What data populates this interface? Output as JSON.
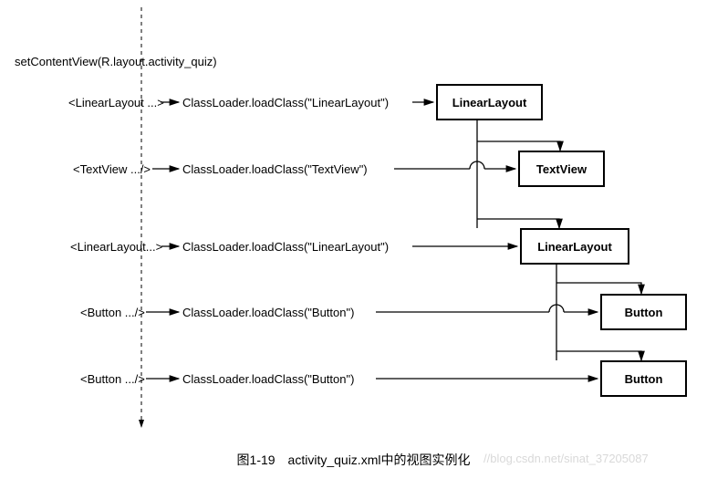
{
  "header": {
    "setContentView": "setContentView(R.layout.activity_quiz)"
  },
  "rows": {
    "r1": {
      "xml": "<LinearLayout ...>",
      "loader": "ClassLoader.loadClass(\"LinearLayout\")",
      "box": "LinearLayout"
    },
    "r2": {
      "xml": "<TextView .../>",
      "loader": "ClassLoader.loadClass(\"TextView\")",
      "box": "TextView"
    },
    "r3": {
      "xml": "<LinearLayout...>",
      "loader": "ClassLoader.loadClass(\"LinearLayout\")",
      "box": "LinearLayout"
    },
    "r4": {
      "xml": "<Button .../>",
      "loader": "ClassLoader.loadClass(\"Button\")",
      "box": "Button"
    },
    "r5": {
      "xml": "<Button .../>",
      "loader": "ClassLoader.loadClass(\"Button\")",
      "box": "Button"
    }
  },
  "caption": "图1-19　activity_quiz.xml中的视图实例化",
  "watermark": "//blog.csdn.net/sinat_37205087"
}
